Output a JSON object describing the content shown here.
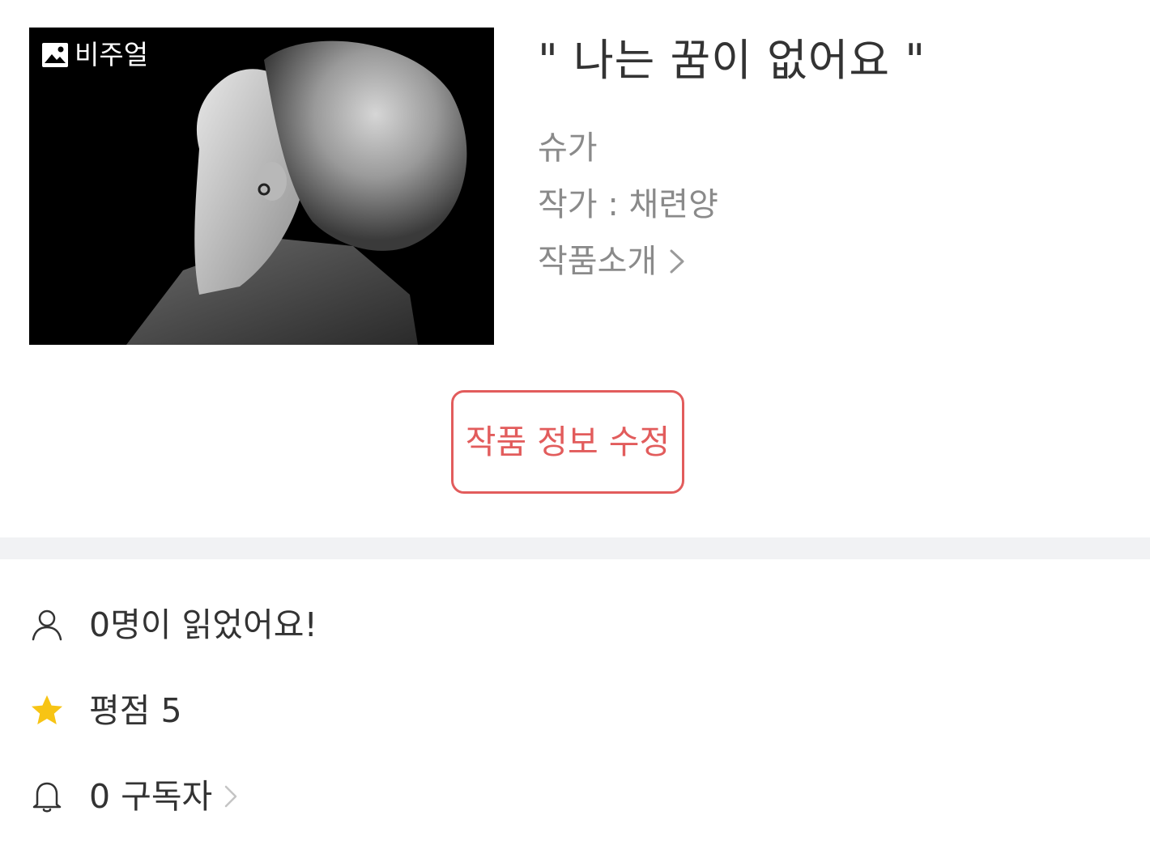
{
  "work": {
    "visual_label": "비주얼",
    "title": "\"  나는 꿈이 없어요  \"",
    "genre": "슈가",
    "author": "작가 : 채련양",
    "intro_label": "작품소개"
  },
  "actions": {
    "edit_label": "작품 정보 수정"
  },
  "stats": {
    "readers": "0명이 읽었어요!",
    "rating": "평점 5",
    "subscribers": "0 구독자"
  },
  "icons": {
    "visual": "image-icon",
    "intro": "chevron-right-icon",
    "readers": "person-icon",
    "rating": "star-icon",
    "subscribers": "bell-icon"
  },
  "colors": {
    "accent": "#e25c5c",
    "star": "#f7c414",
    "divider": "#f1f2f4",
    "muted_text": "#8a8a8a"
  }
}
